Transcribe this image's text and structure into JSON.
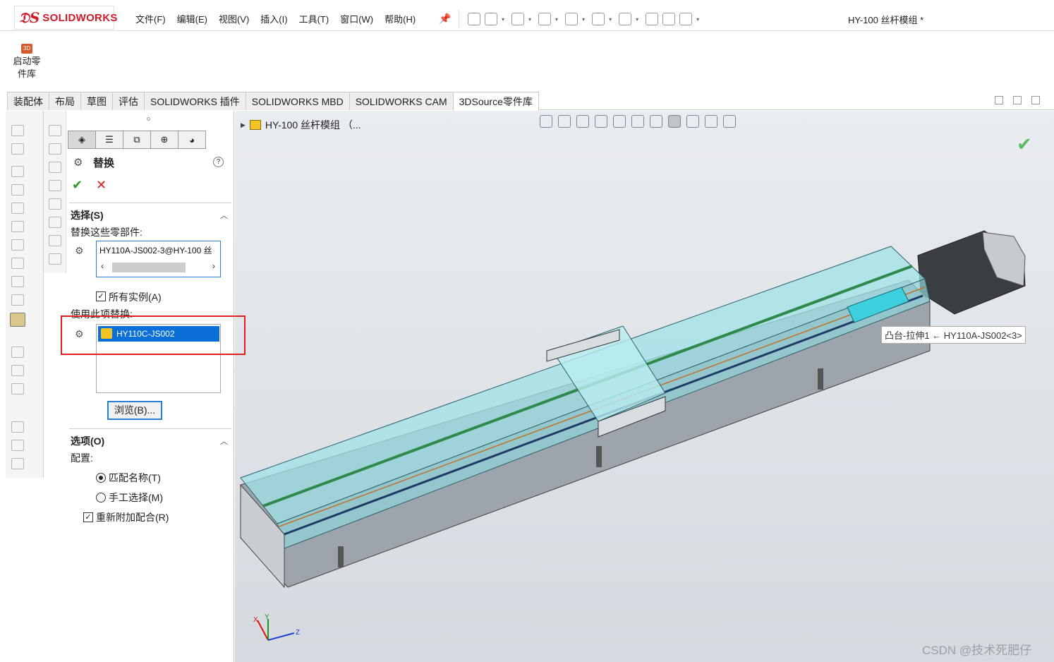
{
  "app": {
    "brand": "SOLIDWORKS",
    "doc_title": "HY-100 丝杆模组 *"
  },
  "menu": [
    "文件(F)",
    "编辑(E)",
    "视图(V)",
    "插入(I)",
    "工具(T)",
    "窗口(W)",
    "帮助(H)"
  ],
  "ribbon": {
    "start_lib_line1": "启动零",
    "start_lib_line2": "件库",
    "start_lib_icon_text": "3D"
  },
  "tabs": [
    {
      "label": "装配体",
      "active": false
    },
    {
      "label": "布局",
      "active": false
    },
    {
      "label": "草图",
      "active": false
    },
    {
      "label": "评估",
      "active": false
    },
    {
      "label": "SOLIDWORKS 插件",
      "active": false
    },
    {
      "label": "SOLIDWORKS MBD",
      "active": false
    },
    {
      "label": "SOLIDWORKS CAM",
      "active": false
    },
    {
      "label": "3DSource零件库",
      "active": true
    }
  ],
  "pm": {
    "title": "替换",
    "help": "?",
    "ok": "✔",
    "cancel": "✕",
    "selection": {
      "title": "选择(S)",
      "replace_label": "替换这些零部件:",
      "replace_item": "HY110A-JS002-3@HY-100 丝",
      "all_instances": "所有实例(A)",
      "with_label": "使用此项替换:",
      "with_item": "HY110C-JS002",
      "browse": "浏览(B)..."
    },
    "options": {
      "title": "选项(O)",
      "config_label": "配置:",
      "match_name": "匹配名称(T)",
      "manual_select": "手工选择(M)",
      "reattach_mates": "重新附加配合(R)"
    }
  },
  "viewport": {
    "tree_label": "HY-100 丝杆模组 （...",
    "tooltip": "凸台-拉伸1 ← HY110A-JS002<3>",
    "watermark": "CSDN @技术死肥仔",
    "axis_x": "X",
    "axis_y": "Y",
    "axis_z": "Z"
  },
  "colors": {
    "accent": "#0a6fd6",
    "highlight_box": "#e02020",
    "brand_red": "#d11a2a",
    "ok_green": "#2e9b2e"
  }
}
